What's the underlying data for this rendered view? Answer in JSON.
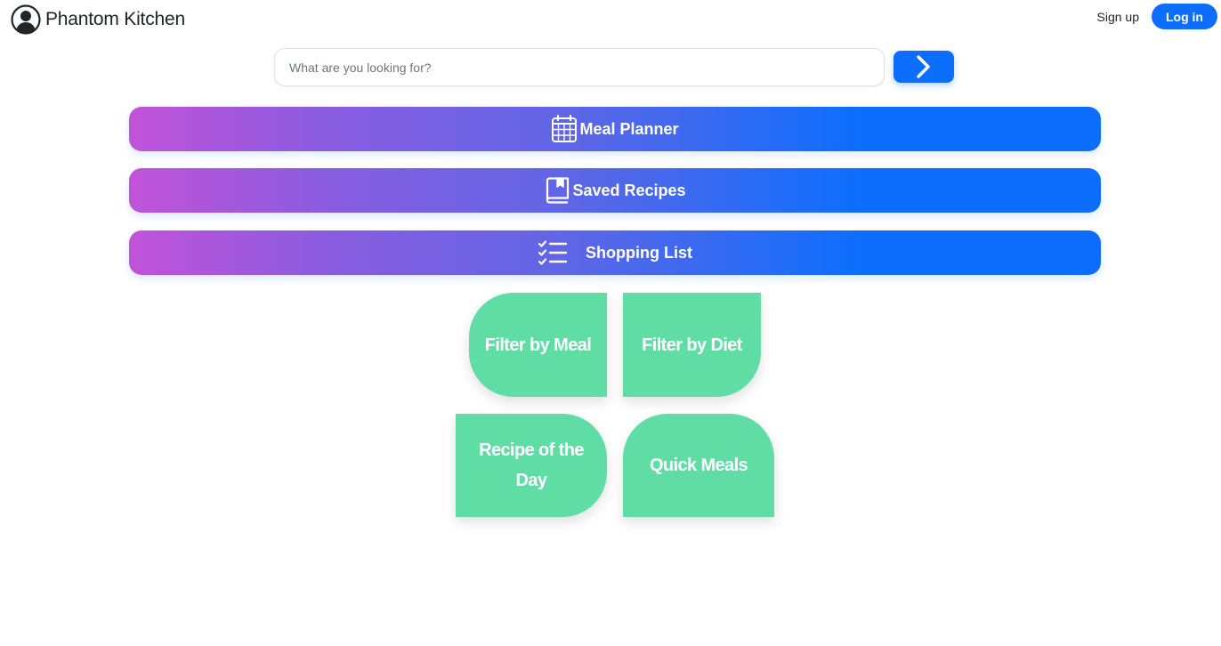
{
  "brand": {
    "name": "Phantom Kitchen",
    "icon": "user-circle-icon"
  },
  "header": {
    "signup_label": "Sign up",
    "login_label": "Log in"
  },
  "search": {
    "placeholder": "What are you looking for?",
    "value": "",
    "button_icon": "chevron-right-icon"
  },
  "features": [
    {
      "label": "Meal Planner",
      "icon": "calendar-icon"
    },
    {
      "label": "Saved Recipes",
      "icon": "book-icon"
    },
    {
      "label": "Shopping List",
      "icon": "checklist-icon"
    }
  ],
  "tiles": [
    {
      "label": "Filter by Meal"
    },
    {
      "label": "Filter by Diet"
    },
    {
      "label": "Recipe of the Day"
    },
    {
      "label": "Quick Meals"
    }
  ],
  "colors": {
    "primary": "#0d6efd",
    "gradient_start": "#c153d9",
    "tile_green": "#5fdda4"
  }
}
